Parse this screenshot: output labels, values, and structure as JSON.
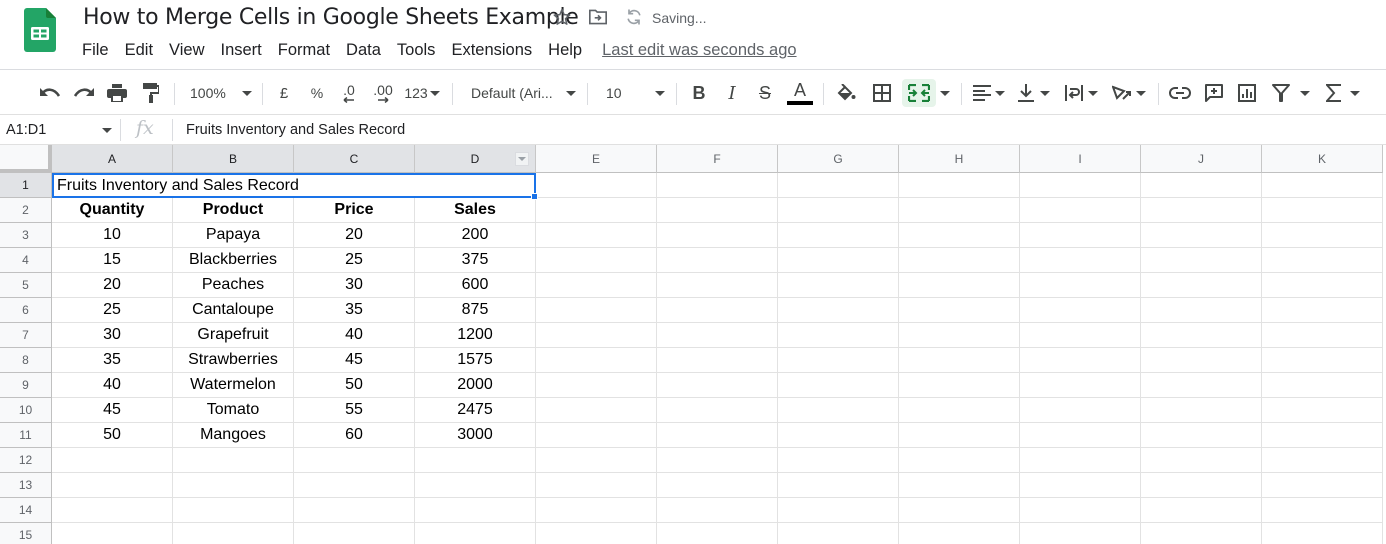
{
  "app": {
    "title": "How to Merge Cells in Google Sheets Example",
    "status": "Saving...",
    "last_edit": "Last edit was seconds ago",
    "brand_color": "#23a566",
    "accent_color": "#1a73e8",
    "icons": {
      "logo": "google-sheets-logo",
      "star": "star-icon",
      "move": "move-to-folder-icon",
      "sync": "sync-icon"
    }
  },
  "menu": [
    "File",
    "Edit",
    "View",
    "Insert",
    "Format",
    "Data",
    "Tools",
    "Extensions",
    "Help"
  ],
  "toolbar": {
    "zoom": "100%",
    "currency": "£",
    "percent": "%",
    "decrease_decimal": ".0",
    "increase_decimal": ".00",
    "more_formats": "123",
    "font": "Default (Ari...",
    "font_size": "10",
    "bold": "B",
    "italic": "I",
    "strikethrough": "S",
    "text_color": "A",
    "text_color_value": "#000000",
    "merge_active": true
  },
  "formula_bar": {
    "name_box": "A1:D1",
    "fx": "fx",
    "value": "Fruits Inventory and Sales Record"
  },
  "grid": {
    "columns": [
      "A",
      "B",
      "C",
      "D",
      "E",
      "F",
      "G",
      "H",
      "I",
      "J",
      "K"
    ],
    "selected_columns": [
      "A",
      "B",
      "C",
      "D"
    ],
    "rows": [
      "1",
      "2",
      "3",
      "4",
      "5",
      "6",
      "7",
      "8",
      "9",
      "10",
      "11",
      "12",
      "13",
      "14",
      "15"
    ],
    "selected_rows": [
      "1"
    ],
    "merged_cell": {
      "range": "A1:D1",
      "value": "Fruits Inventory and Sales Record"
    },
    "headers": [
      "Quantity",
      "Product",
      "Price",
      "Sales"
    ],
    "data": [
      [
        "10",
        "Papaya",
        "20",
        "200"
      ],
      [
        "15",
        "Blackberries",
        "25",
        "375"
      ],
      [
        "20",
        "Peaches",
        "30",
        "600"
      ],
      [
        "25",
        "Cantaloupe",
        "35",
        "875"
      ],
      [
        "30",
        "Grapefruit",
        "40",
        "1200"
      ],
      [
        "35",
        "Strawberries",
        "45",
        "1575"
      ],
      [
        "40",
        "Watermelon",
        "50",
        "2000"
      ],
      [
        "45",
        "Tomato",
        "55",
        "2475"
      ],
      [
        "50",
        "Mangoes",
        "60",
        "3000"
      ]
    ]
  }
}
